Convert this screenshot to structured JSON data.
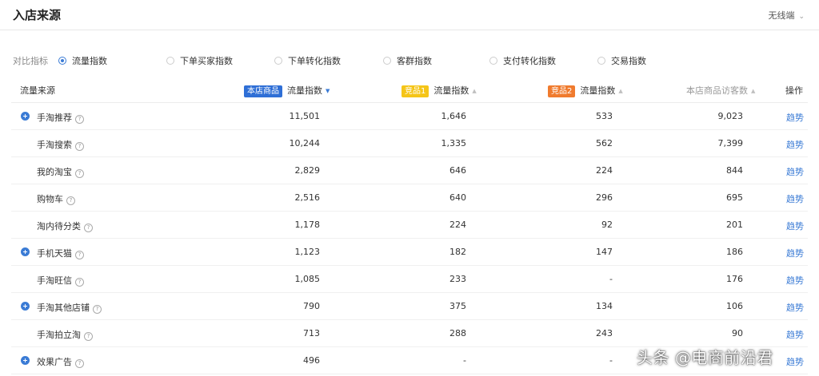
{
  "header": {
    "title": "入店来源",
    "device": "无线端"
  },
  "metrics": {
    "label": "对比指标",
    "options": [
      {
        "label": "流量指数",
        "checked": true
      },
      {
        "label": "下单买家指数",
        "checked": false
      },
      {
        "label": "下单转化指数",
        "checked": false
      },
      {
        "label": "客群指数",
        "checked": false
      },
      {
        "label": "支付转化指数",
        "checked": false
      },
      {
        "label": "交易指数",
        "checked": false
      }
    ]
  },
  "table": {
    "headers": {
      "source": "流量来源",
      "own_badge": "本店商品",
      "own_metric": "流量指数",
      "comp1_badge": "竞品1",
      "comp1_metric": "流量指数",
      "comp2_badge": "竞品2",
      "comp2_metric": "流量指数",
      "visitors": "本店商品访客数",
      "action": "操作"
    },
    "badge_colors": {
      "own": "#2f6fd6",
      "comp1": "#f5c518",
      "comp2": "#f07b2e"
    },
    "action_label": "趋势",
    "rows": [
      {
        "name": "手淘推荐",
        "expandable": true,
        "own": "11,501",
        "comp1": "1,646",
        "comp2": "533",
        "visitors": "9,023"
      },
      {
        "name": "手淘搜索",
        "expandable": false,
        "own": "10,244",
        "comp1": "1,335",
        "comp2": "562",
        "visitors": "7,399"
      },
      {
        "name": "我的淘宝",
        "expandable": false,
        "own": "2,829",
        "comp1": "646",
        "comp2": "224",
        "visitors": "844"
      },
      {
        "name": "购物车",
        "expandable": false,
        "own": "2,516",
        "comp1": "640",
        "comp2": "296",
        "visitors": "695"
      },
      {
        "name": "淘内待分类",
        "expandable": false,
        "own": "1,178",
        "comp1": "224",
        "comp2": "92",
        "visitors": "201"
      },
      {
        "name": "手机天猫",
        "expandable": true,
        "own": "1,123",
        "comp1": "182",
        "comp2": "147",
        "visitors": "186"
      },
      {
        "name": "手淘旺信",
        "expandable": false,
        "own": "1,085",
        "comp1": "233",
        "comp2": "-",
        "visitors": "176"
      },
      {
        "name": "手淘其他店铺",
        "expandable": true,
        "own": "790",
        "comp1": "375",
        "comp2": "134",
        "visitors": "106"
      },
      {
        "name": "手淘拍立淘",
        "expandable": false,
        "own": "713",
        "comp1": "288",
        "comp2": "243",
        "visitors": "90"
      },
      {
        "name": "效果广告",
        "expandable": true,
        "own": "496",
        "comp1": "-",
        "comp2": "-",
        "visitors": ""
      }
    ]
  },
  "watermark": "头条 @电商前沿君",
  "colors": {
    "accent": "#3a7bd5"
  }
}
